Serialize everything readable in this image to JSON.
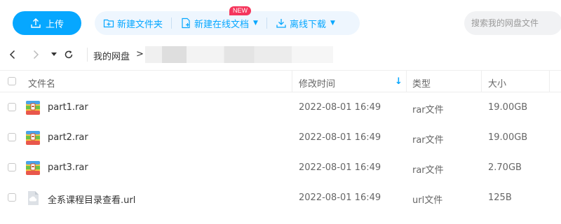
{
  "toolbar": {
    "upload_label": "上传",
    "new_folder_label": "新建文件夹",
    "new_online_doc_label": "新建在线文档",
    "new_badge": "NEW",
    "offline_download_label": "离线下载",
    "search_placeholder": "搜索我的网盘文件"
  },
  "nav": {
    "breadcrumb_root": "我的网盘",
    "breadcrumb_separator": ">"
  },
  "table": {
    "headers": {
      "name": "文件名",
      "modified": "修改时间",
      "type": "类型",
      "size": "大小"
    },
    "sort_indicator": "↓",
    "rows": [
      {
        "name": "part1.rar",
        "modified": "2022-08-01 16:49",
        "type": "rar文件",
        "size": "19.00GB",
        "icon": "rar-archive-icon"
      },
      {
        "name": "part2.rar",
        "modified": "2022-08-01 16:49",
        "type": "rar文件",
        "size": "19.00GB",
        "icon": "rar-archive-icon"
      },
      {
        "name": "part3.rar",
        "modified": "2022-08-01 16:49",
        "type": "rar文件",
        "size": "2.70GB",
        "icon": "rar-archive-icon"
      },
      {
        "name": "全系课程目录查看.url",
        "modified": "2022-08-01 16:49",
        "type": "url文件",
        "size": "125B",
        "icon": "url-file-icon"
      }
    ]
  },
  "colors": {
    "accent": "#06a7ff",
    "toolbar_group_bg": "#eef6fe",
    "new_badge_bg": "#f5365c"
  }
}
